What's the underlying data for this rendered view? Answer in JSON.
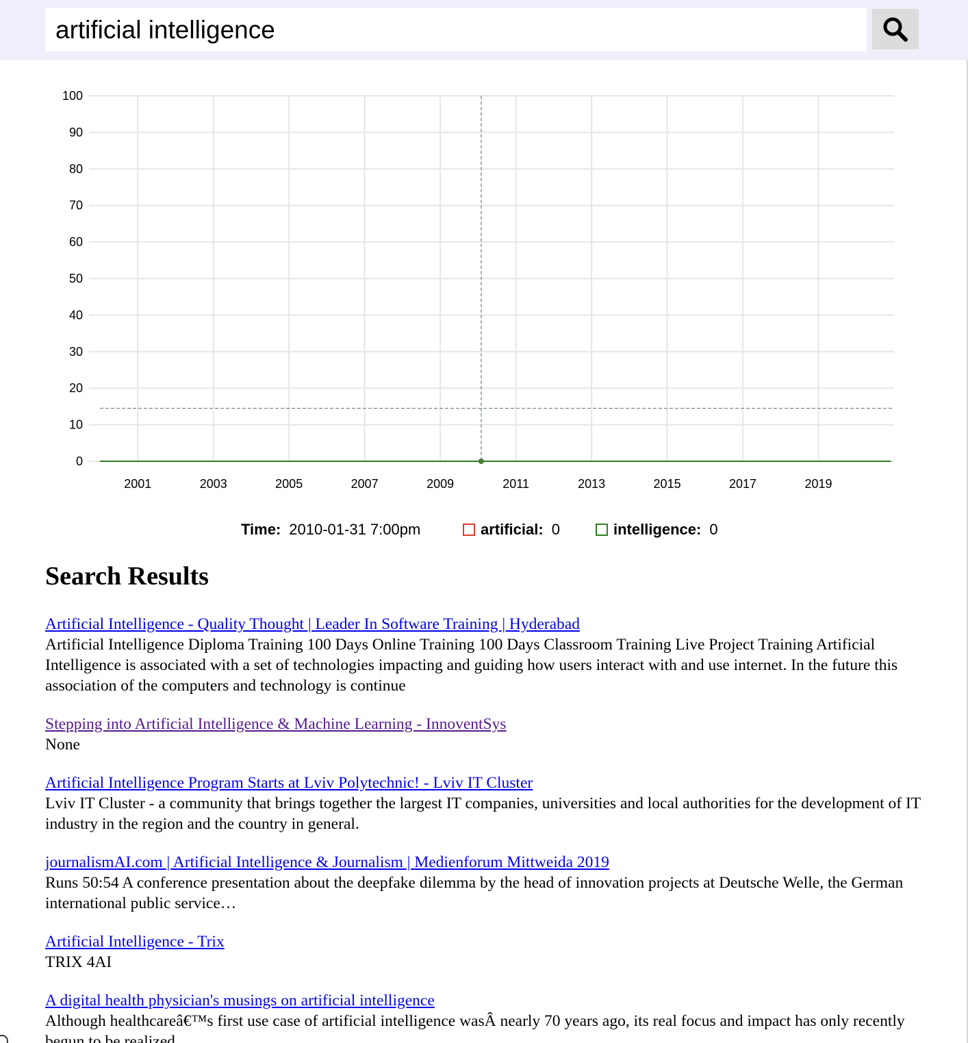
{
  "search": {
    "query": "artificial intelligence"
  },
  "chart_data": {
    "type": "line",
    "x_ticks": [
      "2001",
      "2003",
      "2005",
      "2007",
      "2009",
      "2011",
      "2013",
      "2015",
      "2017",
      "2019"
    ],
    "y_ticks": [
      "100",
      "90",
      "80",
      "70",
      "60",
      "50",
      "40",
      "30",
      "20",
      "10",
      "0"
    ],
    "ylim": [
      0,
      100
    ],
    "xlim": [
      "2000-01",
      "2020-12"
    ],
    "grid": true,
    "series": [
      {
        "name": "artificial",
        "color": "#e03a2f",
        "x": [
          "2000-01",
          "2020-12"
        ],
        "values": [
          0,
          0
        ]
      },
      {
        "name": "intelligence",
        "color": "#2e7d22",
        "x": [
          "2000-01",
          "2020-12"
        ],
        "values": [
          0,
          0
        ]
      }
    ],
    "crosshair": {
      "x": "2010-01-31",
      "y": 14.5
    }
  },
  "legend": {
    "time_label": "Time:",
    "time_value": "2010-01-31 7:00pm",
    "items": [
      {
        "label": "artificial:",
        "value": "0",
        "color": "#e03a2f"
      },
      {
        "label": "intelligence:",
        "value": "0",
        "color": "#2e7d22"
      }
    ]
  },
  "results_title": "Search Results",
  "results": [
    {
      "title": "Artificial Intelligence - Quality Thought | Leader In Software Training | Hyderabad",
      "snippet": "Artificial Intelligence Diploma Training 100 Days Online Training 100 Days Classroom Training Live Project Training Artificial Intelligence is associated with a set of technologies impacting and guiding how users interact with and use internet. In the future this association of the computers and technology is continue",
      "visited": false
    },
    {
      "title": "Stepping into Artificial Intelligence & Machine Learning - InnoventSys",
      "snippet": "None",
      "visited": true
    },
    {
      "title": "Artificial Intelligence Program Starts at Lviv Polytechnic! - Lviv IT Cluster",
      "snippet": "Lviv IT Cluster - a community that brings together the largest IT companies, universities and local authorities for the development of IT industry in the region and the country in general.",
      "visited": false
    },
    {
      "title": "journalismAI.com | Artificial Intelligence & Journalism | Medienforum Mittweida 2019",
      "snippet": "Runs 50:54 A conference presentation about the deepfake dilemma by the head of innovation projects at Deutsche Welle, the German international public service…",
      "visited": false
    },
    {
      "title": "Artificial Intelligence - Trix",
      "snippet": "TRIX 4AI",
      "visited": false
    },
    {
      "title": "A digital health physician's musings on artificial intelligence",
      "snippet": "Although healthcareâ€™s first use case of artificial intelligence wasÂ nearly 70 years ago, its real focus and impact has only recently begun to be realized.",
      "visited": false
    }
  ]
}
